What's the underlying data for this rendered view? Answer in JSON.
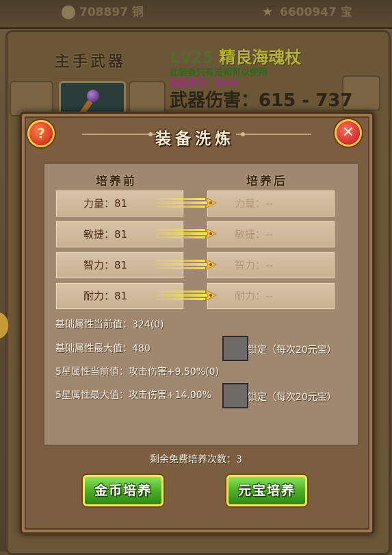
{
  "background": {
    "gold_amount": "708897",
    "gold_unit": "铜",
    "ingot_amount": "6600947",
    "ingot_unit": "宝",
    "weapon_slot_title": "主手武器",
    "weapon_level": "Lv25",
    "weapon_name": "精良海魂杖",
    "weapon_note": "此装备只有法师可以使用",
    "weapon_score": "装备评分：1676",
    "weapon_damage": "武器伤害：615 - 737"
  },
  "dialog": {
    "title": "装备洗炼",
    "help_icon": "question-mark-icon",
    "close_icon": "close-x-icon",
    "header_before": "培养前",
    "header_after": "培养后",
    "stats_before": [
      {
        "label": "力量：81"
      },
      {
        "label": "敏捷：81"
      },
      {
        "label": "智力：81"
      },
      {
        "label": "耐力：81"
      }
    ],
    "stats_after": [
      {
        "label": "力量：--"
      },
      {
        "label": "敏捷：--"
      },
      {
        "label": "智力：--"
      },
      {
        "label": "耐力：--"
      }
    ],
    "base_current": "基础属性当前值：324(0)",
    "base_max": "基础属性最大值：480",
    "star_current": "5星属性当前值：攻击伤害+9.50%(0)",
    "star_max": "5星属性最大值：攻击伤害+14.00%",
    "lock_label_1": "锁定（每次20元宝）",
    "lock_label_2": "锁定（每次20元宝）",
    "remaining_free": "剩余免费培养次数：3",
    "gold_train_button": "金币培养",
    "ingot_train_button": "元宝培养"
  },
  "colors": {
    "dialog_bg": "#7b5e40",
    "panel_bg": "#9f8770",
    "button_green": "#4fb529",
    "close_red": "#c01818"
  }
}
